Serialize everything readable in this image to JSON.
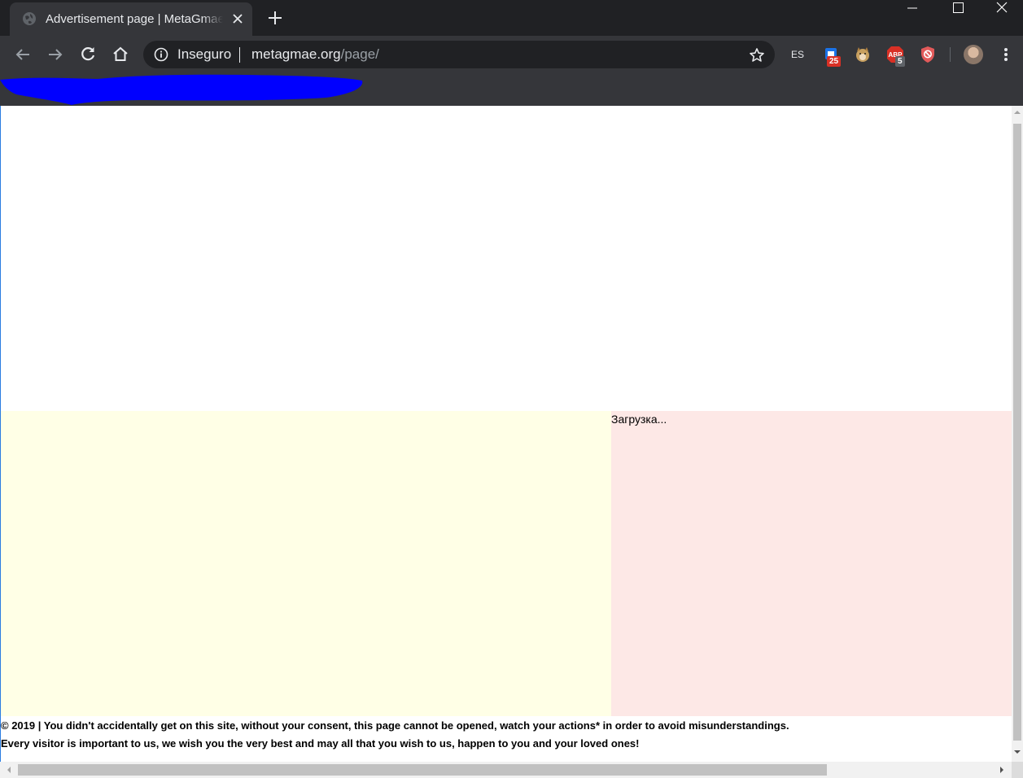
{
  "browser": {
    "tab": {
      "title": "Advertisement page | MetaGmae"
    },
    "omnibox": {
      "security_label": "Inseguro",
      "url_host": "metagmae.org",
      "url_path": "/page/"
    },
    "extensions": {
      "es_label": "ES",
      "calendar_badge": "25",
      "adblock_badge": "5"
    },
    "colors": {
      "chrome_dark": "#202124",
      "toolbar": "#35363a",
      "badge_red": "#d93025",
      "redaction_blue": "#0000ff"
    }
  },
  "page": {
    "loading_text": "Загрузка...",
    "footer_line1": "© 2019 | You didn't accidentally get on this site, without your consent, this page cannot be opened, watch your actions* in order to avoid misunderstandings.",
    "footer_line2": "Every visitor is important to us, we wish you the very best and may all that you wish to us, happen to you and your loved ones!",
    "colors": {
      "left_block": "#ffffe6",
      "right_block": "#fde8e6"
    }
  }
}
